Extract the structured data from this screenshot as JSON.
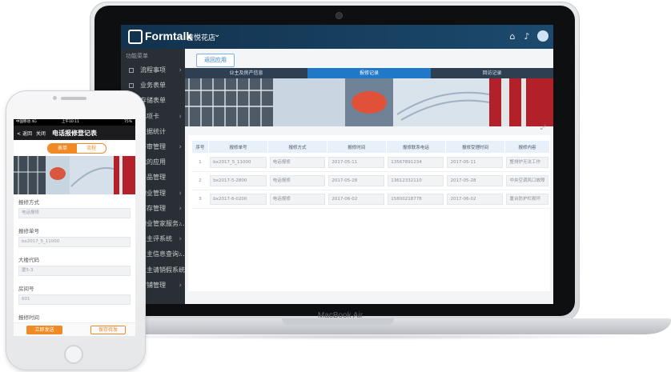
{
  "laptop": {
    "brand": "MacBook Air"
  },
  "app": {
    "logo": "Formtalk",
    "store": "喜悦花店",
    "topbar_icons": [
      "store-icon",
      "bell-icon",
      "user-avatar"
    ],
    "sidebar_header": "功能菜单",
    "sidebar": [
      {
        "label": "流程事项",
        "arrow": true
      },
      {
        "label": "业务表单",
        "arrow": false
      },
      {
        "label": "存储表单",
        "arrow": false
      },
      {
        "label": "选项卡",
        "arrow": true
      },
      {
        "label": "数据统计",
        "arrow": false
      },
      {
        "label": "评审管理",
        "arrow": true
      },
      {
        "label": "我的应用",
        "arrow": false
      },
      {
        "label": "产品管理",
        "arrow": false
      },
      {
        "label": "物业管理",
        "arrow": true
      },
      {
        "label": "库存管理",
        "arrow": true
      },
      {
        "label": "物业管家服务...",
        "arrow": true
      },
      {
        "label": "业主评系统",
        "arrow": true
      },
      {
        "label": "业主信息查询...",
        "arrow": true
      },
      {
        "label": "业主请销假系统",
        "arrow": true
      },
      {
        "label": "店铺管理",
        "arrow": true
      }
    ],
    "back_button": "返回应用",
    "tabs": [
      "业主及房产信息",
      "报修记录",
      "回访记录"
    ],
    "table": {
      "headers": [
        "序号",
        "报修单号",
        "报修方式",
        "报修时间",
        "报修联系电话",
        "报修受理时间",
        "报修内容"
      ],
      "rows": [
        [
          "1",
          "bx2017_5_11000",
          "电话报修",
          "2017-05-11",
          "13567891234",
          "2017-05-11",
          "整排炉无法工作"
        ],
        [
          "2",
          "bx2017-5-2800",
          "电话报修",
          "2017-05-28",
          "13612332110",
          "2017-05-28",
          "中央空调风口故障"
        ],
        [
          "3",
          "bx2017-6-0200",
          "电话报修",
          "2017-06-02",
          "15800218778",
          "2017-06-02",
          "厦台防护栏损坏"
        ]
      ]
    }
  },
  "phone": {
    "status_left": "中国移动 4G",
    "status_center": "上午10:11",
    "status_right": "75%",
    "back": "返回",
    "close": "关闭",
    "title": "电话报修登记表",
    "seg_form": "表单",
    "seg_flow": "流程",
    "fields": [
      {
        "label": "报修方式",
        "value": "电话报修"
      },
      {
        "label": "报修单号",
        "value": "bx2017_5_11000"
      },
      {
        "label": "大楼代码",
        "value": "厦5-3"
      },
      {
        "label": "房间号",
        "value": "601"
      },
      {
        "label": "报修时间",
        "value": ""
      }
    ],
    "submit": "立即发送",
    "save": "保存待发"
  }
}
